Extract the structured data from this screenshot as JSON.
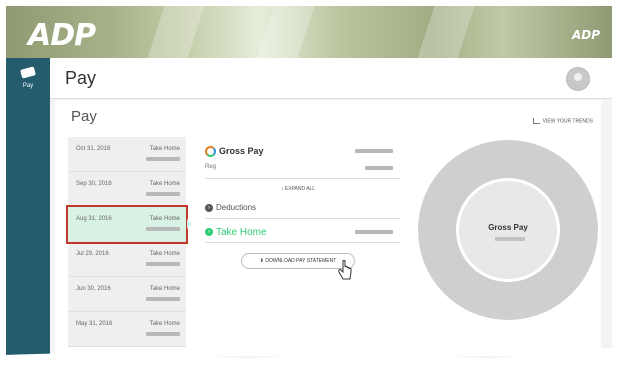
{
  "app": {
    "logo": "ADP",
    "logo_small": "ADP"
  },
  "sidebar": {
    "nav_label": "Pay"
  },
  "header": {
    "title": "Pay"
  },
  "section": {
    "title": "Pay",
    "trends_label": "VIEW YOUR TRENDS"
  },
  "statements": [
    {
      "date": "Oct 31, 2016",
      "label": "Take Home"
    },
    {
      "date": "Sep 30, 2016",
      "label": "Take Home"
    },
    {
      "date": "Aug 31, 2016",
      "label": "Take Home",
      "selected": true
    },
    {
      "date": "Jul 29, 2016",
      "label": "Take Home"
    },
    {
      "date": "Jun 30, 2016",
      "label": "Take Home"
    },
    {
      "date": "May 31, 2016",
      "label": "Take Home"
    }
  ],
  "details": {
    "gross_pay": "Gross Pay",
    "reg": "Reg",
    "expand_all": "EXPAND ALL",
    "deductions": "Deductions",
    "take_home": "Take Home",
    "download": "DOWNLOAD PAY STATEMENT"
  },
  "chart": {
    "center_label": "Gross Pay"
  },
  "colors": {
    "nav": "#245c6e",
    "selected_row": "#d8f2e6",
    "highlight_border": "#c0392b",
    "take_home": "#2ecc71"
  }
}
